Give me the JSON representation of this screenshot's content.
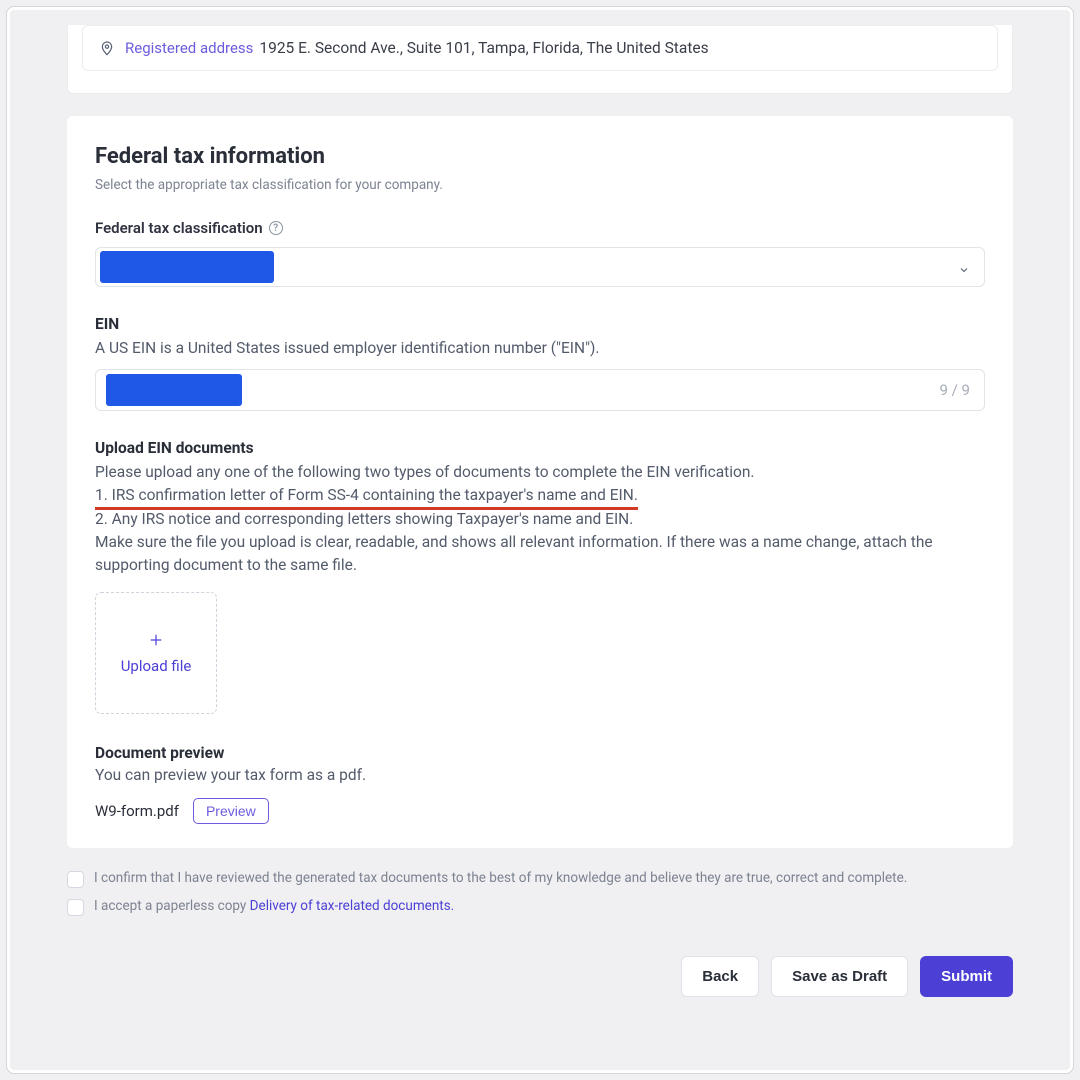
{
  "address": {
    "label": "Registered address",
    "value": "1925 E. Second Ave., Suite 101, Tampa, Florida, The United States"
  },
  "section": {
    "title": "Federal tax information",
    "subtitle": "Select the appropriate tax classification for your company."
  },
  "classification": {
    "label": "Federal tax classification"
  },
  "ein": {
    "label": "EIN",
    "help": "A US EIN is a United States issued employer identification number (\"EIN\").",
    "counter": "9 / 9"
  },
  "upload": {
    "label": "Upload EIN documents",
    "line_intro": "Please upload any one of the following two types of documents to complete the EIN verification.",
    "line1": "1. IRS confirmation letter of Form SS-4 containing the taxpayer's name and EIN.",
    "line2": "2. Any IRS notice and corresponding letters showing Taxpayer's name and EIN.",
    "line_note": "Make sure the file you upload is clear, readable, and shows all relevant information. If there was a name change, attach the supporting document to the same file.",
    "button_text": "Upload file"
  },
  "preview": {
    "label": "Document preview",
    "desc": "You can preview your tax form as a pdf.",
    "filename": "W9-form.pdf",
    "button": "Preview"
  },
  "checks": {
    "confirm": "I confirm that I have reviewed the generated tax documents to the best of my knowledge and believe they are true, correct and complete.",
    "paperless_prefix": "I accept a paperless copy ",
    "paperless_link": "Delivery of tax-related documents."
  },
  "footer": {
    "back": "Back",
    "draft": "Save as Draft",
    "submit": "Submit"
  }
}
